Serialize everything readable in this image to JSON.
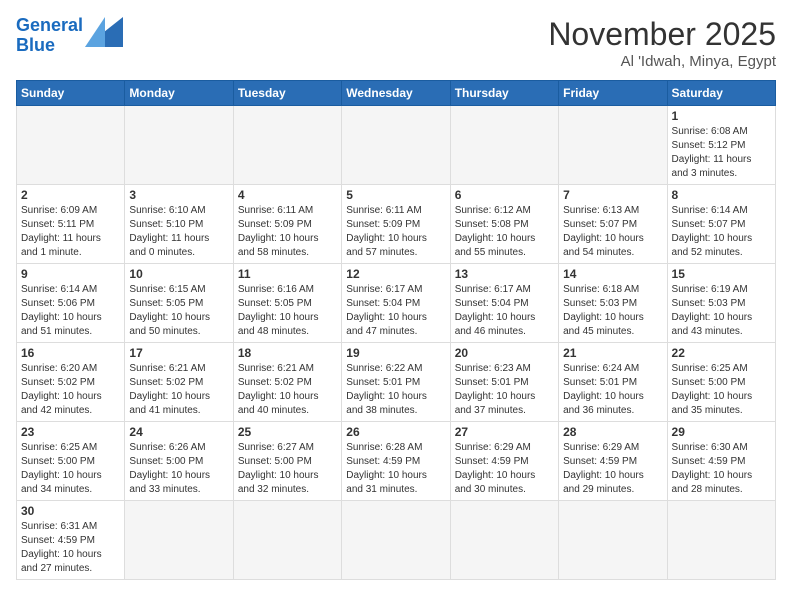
{
  "header": {
    "logo_general": "General",
    "logo_blue": "Blue",
    "month_title": "November 2025",
    "location": "Al 'Idwah, Minya, Egypt"
  },
  "weekdays": [
    "Sunday",
    "Monday",
    "Tuesday",
    "Wednesday",
    "Thursday",
    "Friday",
    "Saturday"
  ],
  "weeks": [
    [
      {
        "day": "",
        "info": ""
      },
      {
        "day": "",
        "info": ""
      },
      {
        "day": "",
        "info": ""
      },
      {
        "day": "",
        "info": ""
      },
      {
        "day": "",
        "info": ""
      },
      {
        "day": "",
        "info": ""
      },
      {
        "day": "1",
        "info": "Sunrise: 6:08 AM\nSunset: 5:12 PM\nDaylight: 11 hours\nand 3 minutes."
      }
    ],
    [
      {
        "day": "2",
        "info": "Sunrise: 6:09 AM\nSunset: 5:11 PM\nDaylight: 11 hours\nand 1 minute."
      },
      {
        "day": "3",
        "info": "Sunrise: 6:10 AM\nSunset: 5:10 PM\nDaylight: 11 hours\nand 0 minutes."
      },
      {
        "day": "4",
        "info": "Sunrise: 6:11 AM\nSunset: 5:09 PM\nDaylight: 10 hours\nand 58 minutes."
      },
      {
        "day": "5",
        "info": "Sunrise: 6:11 AM\nSunset: 5:09 PM\nDaylight: 10 hours\nand 57 minutes."
      },
      {
        "day": "6",
        "info": "Sunrise: 6:12 AM\nSunset: 5:08 PM\nDaylight: 10 hours\nand 55 minutes."
      },
      {
        "day": "7",
        "info": "Sunrise: 6:13 AM\nSunset: 5:07 PM\nDaylight: 10 hours\nand 54 minutes."
      },
      {
        "day": "8",
        "info": "Sunrise: 6:14 AM\nSunset: 5:07 PM\nDaylight: 10 hours\nand 52 minutes."
      }
    ],
    [
      {
        "day": "9",
        "info": "Sunrise: 6:14 AM\nSunset: 5:06 PM\nDaylight: 10 hours\nand 51 minutes."
      },
      {
        "day": "10",
        "info": "Sunrise: 6:15 AM\nSunset: 5:05 PM\nDaylight: 10 hours\nand 50 minutes."
      },
      {
        "day": "11",
        "info": "Sunrise: 6:16 AM\nSunset: 5:05 PM\nDaylight: 10 hours\nand 48 minutes."
      },
      {
        "day": "12",
        "info": "Sunrise: 6:17 AM\nSunset: 5:04 PM\nDaylight: 10 hours\nand 47 minutes."
      },
      {
        "day": "13",
        "info": "Sunrise: 6:17 AM\nSunset: 5:04 PM\nDaylight: 10 hours\nand 46 minutes."
      },
      {
        "day": "14",
        "info": "Sunrise: 6:18 AM\nSunset: 5:03 PM\nDaylight: 10 hours\nand 45 minutes."
      },
      {
        "day": "15",
        "info": "Sunrise: 6:19 AM\nSunset: 5:03 PM\nDaylight: 10 hours\nand 43 minutes."
      }
    ],
    [
      {
        "day": "16",
        "info": "Sunrise: 6:20 AM\nSunset: 5:02 PM\nDaylight: 10 hours\nand 42 minutes."
      },
      {
        "day": "17",
        "info": "Sunrise: 6:21 AM\nSunset: 5:02 PM\nDaylight: 10 hours\nand 41 minutes."
      },
      {
        "day": "18",
        "info": "Sunrise: 6:21 AM\nSunset: 5:02 PM\nDaylight: 10 hours\nand 40 minutes."
      },
      {
        "day": "19",
        "info": "Sunrise: 6:22 AM\nSunset: 5:01 PM\nDaylight: 10 hours\nand 38 minutes."
      },
      {
        "day": "20",
        "info": "Sunrise: 6:23 AM\nSunset: 5:01 PM\nDaylight: 10 hours\nand 37 minutes."
      },
      {
        "day": "21",
        "info": "Sunrise: 6:24 AM\nSunset: 5:01 PM\nDaylight: 10 hours\nand 36 minutes."
      },
      {
        "day": "22",
        "info": "Sunrise: 6:25 AM\nSunset: 5:00 PM\nDaylight: 10 hours\nand 35 minutes."
      }
    ],
    [
      {
        "day": "23",
        "info": "Sunrise: 6:25 AM\nSunset: 5:00 PM\nDaylight: 10 hours\nand 34 minutes."
      },
      {
        "day": "24",
        "info": "Sunrise: 6:26 AM\nSunset: 5:00 PM\nDaylight: 10 hours\nand 33 minutes."
      },
      {
        "day": "25",
        "info": "Sunrise: 6:27 AM\nSunset: 5:00 PM\nDaylight: 10 hours\nand 32 minutes."
      },
      {
        "day": "26",
        "info": "Sunrise: 6:28 AM\nSunset: 4:59 PM\nDaylight: 10 hours\nand 31 minutes."
      },
      {
        "day": "27",
        "info": "Sunrise: 6:29 AM\nSunset: 4:59 PM\nDaylight: 10 hours\nand 30 minutes."
      },
      {
        "day": "28",
        "info": "Sunrise: 6:29 AM\nSunset: 4:59 PM\nDaylight: 10 hours\nand 29 minutes."
      },
      {
        "day": "29",
        "info": "Sunrise: 6:30 AM\nSunset: 4:59 PM\nDaylight: 10 hours\nand 28 minutes."
      }
    ],
    [
      {
        "day": "30",
        "info": "Sunrise: 6:31 AM\nSunset: 4:59 PM\nDaylight: 10 hours\nand 27 minutes."
      },
      {
        "day": "",
        "info": ""
      },
      {
        "day": "",
        "info": ""
      },
      {
        "day": "",
        "info": ""
      },
      {
        "day": "",
        "info": ""
      },
      {
        "day": "",
        "info": ""
      },
      {
        "day": "",
        "info": ""
      }
    ]
  ]
}
